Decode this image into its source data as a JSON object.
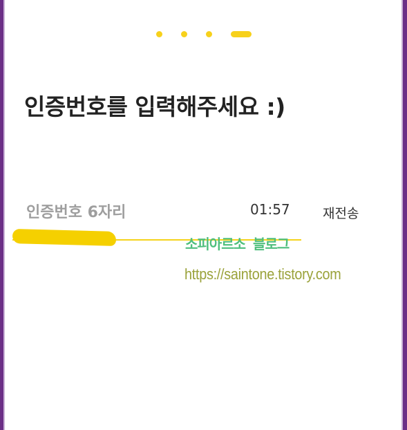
{
  "progress": {
    "total_steps": 4,
    "current_step": 4
  },
  "title": "인증번호를 입력해주세요 :)",
  "verification": {
    "placeholder": "인증번호 6자리",
    "value": "",
    "timer": "01:57",
    "resend_label": "재전송"
  },
  "watermark": {
    "name": "소피아르소 블로그",
    "url": "https://saintone.tistory.com"
  },
  "colors": {
    "accent": "#f7d11b",
    "frame": "#6b2f86",
    "watermark_name": "#4fbf7d",
    "watermark_url": "#9aa23a"
  }
}
